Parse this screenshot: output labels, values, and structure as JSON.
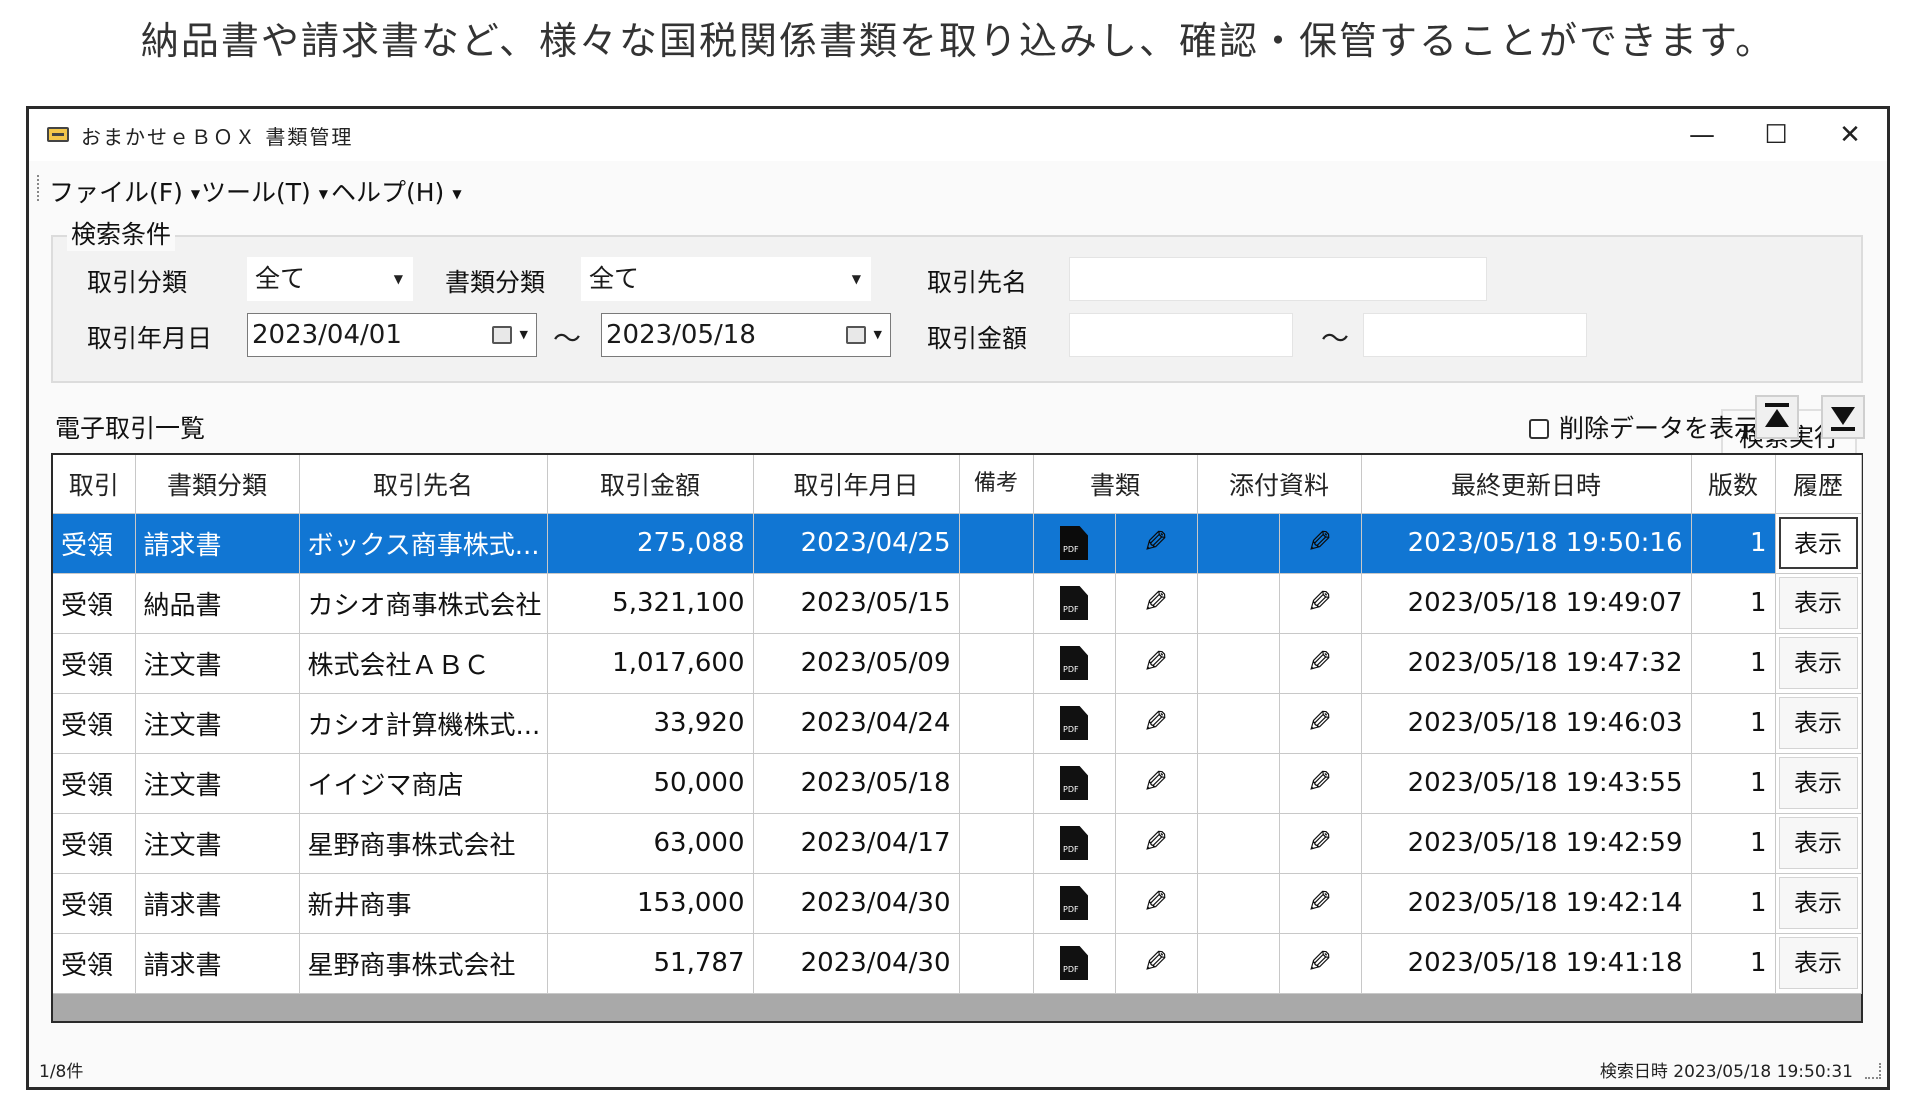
{
  "caption": "納品書や請求書など、様々な国税関係書類を取り込みし、確認・保管することができます。",
  "window": {
    "title": "おまかせｅＢＯＸ 書類管理",
    "controls": {
      "minimize": "—",
      "maximize": "☐",
      "close": "✕"
    }
  },
  "menu": {
    "items": [
      {
        "label": "ファイル(F)"
      },
      {
        "label": "ツール(T)"
      },
      {
        "label": "ヘルプ(H)"
      }
    ]
  },
  "search": {
    "group_label": "検索条件",
    "transaction_type_label": "取引分類",
    "transaction_type_value": "全て",
    "document_type_label": "書類分類",
    "document_type_value": "全て",
    "partner_label": "取引先名",
    "partner_value": "",
    "date_label": "取引年月日",
    "date_from": "2023/04/01",
    "date_to": "2023/05/18",
    "amount_label": "取引金額",
    "amount_from": "",
    "amount_to": "",
    "tilde": "～",
    "execute_label": "検索実行"
  },
  "list": {
    "title": "電子取引一覧",
    "show_deleted_label": "削除データを表示",
    "columns": [
      "取引",
      "書類分類",
      "取引先名",
      "取引金額",
      "取引年月日",
      "備考",
      "書類",
      "添付資料",
      "最終更新日時",
      "版数",
      "履歴"
    ],
    "show_label": "表示",
    "rows": [
      {
        "kind": "受領",
        "doc": "請求書",
        "partner": "ボックス商事株式...",
        "amount": "275,088",
        "date": "2023/04/25",
        "note": "",
        "updated": "2023/05/18 19:50:16",
        "version": "1",
        "selected": true
      },
      {
        "kind": "受領",
        "doc": "納品書",
        "partner": "カシオ商事株式会社",
        "amount": "5,321,100",
        "date": "2023/05/15",
        "note": "",
        "updated": "2023/05/18 19:49:07",
        "version": "1",
        "selected": false
      },
      {
        "kind": "受領",
        "doc": "注文書",
        "partner": "株式会社ＡＢＣ",
        "amount": "1,017,600",
        "date": "2023/05/09",
        "note": "",
        "updated": "2023/05/18 19:47:32",
        "version": "1",
        "selected": false
      },
      {
        "kind": "受領",
        "doc": "注文書",
        "partner": "カシオ計算機株式...",
        "amount": "33,920",
        "date": "2023/04/24",
        "note": "",
        "updated": "2023/05/18 19:46:03",
        "version": "1",
        "selected": false
      },
      {
        "kind": "受領",
        "doc": "注文書",
        "partner": "イイジマ商店",
        "amount": "50,000",
        "date": "2023/05/18",
        "note": "",
        "updated": "2023/05/18 19:43:55",
        "version": "1",
        "selected": false
      },
      {
        "kind": "受領",
        "doc": "注文書",
        "partner": "星野商事株式会社",
        "amount": "63,000",
        "date": "2023/04/17",
        "note": "",
        "updated": "2023/05/18 19:42:59",
        "version": "1",
        "selected": false
      },
      {
        "kind": "受領",
        "doc": "請求書",
        "partner": "新井商事",
        "amount": "153,000",
        "date": "2023/04/30",
        "note": "",
        "updated": "2023/05/18 19:42:14",
        "version": "1",
        "selected": false
      },
      {
        "kind": "受領",
        "doc": "請求書",
        "partner": "星野商事株式会社",
        "amount": "51,787",
        "date": "2023/04/30",
        "note": "",
        "updated": "2023/05/18 19:41:18",
        "version": "1",
        "selected": false
      }
    ]
  },
  "status": {
    "count": "1/8件",
    "search_time": "検索日時 2023/05/18 19:50:31"
  },
  "colors": {
    "selection": "#1176d3",
    "window_border": "#2a2a2a",
    "grid_empty": "#a9a9a9"
  }
}
